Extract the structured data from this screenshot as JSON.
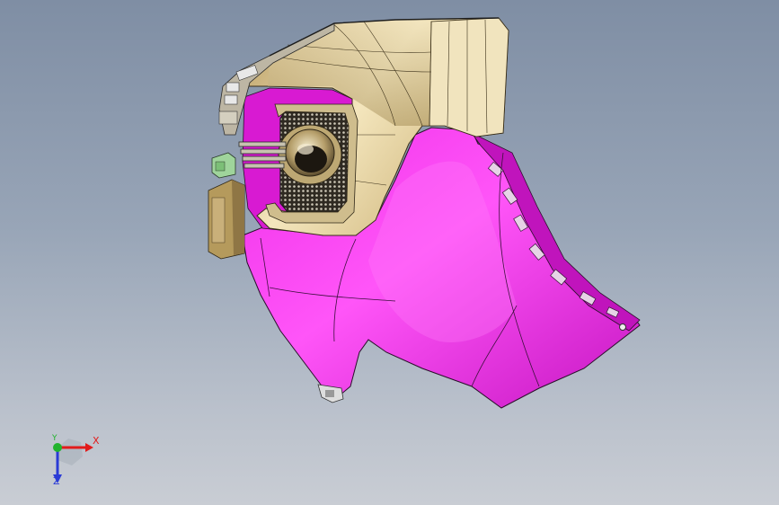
{
  "viewport": {
    "background_top": "#7f8ea4",
    "background_bottom": "#c9cdd4"
  },
  "model": {
    "part_colors": {
      "fender_panel": "#e619e0",
      "fender_shade": "#b40fb0",
      "bezel_housing": "#d8c38e",
      "bezel_shadow": "#a8915a",
      "interior_panel": "#d81ad2",
      "fog_lamp_mesh": "#2f2a22",
      "edge_lines": "#1d1d1d"
    },
    "icons": [
      "fog-lamp-icon",
      "clip-connector-icon",
      "bracket-icon"
    ]
  },
  "triad": {
    "x_label": "X",
    "y_label": "Y",
    "z_label": "Z",
    "x_color": "#e21b1b",
    "y_color": "#22b32e",
    "z_color": "#2a3bd6"
  }
}
